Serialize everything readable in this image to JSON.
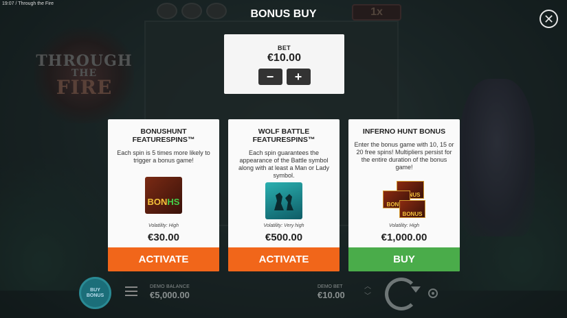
{
  "status_bar": {
    "text": "19:07  /  Through the Fire"
  },
  "background": {
    "logo_line1": "THROUGH",
    "logo_line2": "THE",
    "logo_line3": "FIRE",
    "multiplier": "1x"
  },
  "header": {
    "title": "BONUS BUY",
    "close_icon": "close-icon"
  },
  "bet": {
    "label": "BET",
    "value": "€10.00",
    "minus": "−",
    "plus": "+"
  },
  "cards": [
    {
      "title": "BONUSHUNT FEATURESPINS™",
      "description": "Each spin is 5 times more likely to trigger a bonus game!",
      "image_icon": "bonus-hunt-icon",
      "image_text_1": "BON",
      "image_text_2": "HS",
      "volatility": "Volatility: High",
      "price": "€30.00",
      "action": "ACTIVATE",
      "action_color": "#f1661a"
    },
    {
      "title": "WOLF BATTLE FEATURESPINS™",
      "description": "Each spin guarantees the appearance of the Battle symbol along with at least a Man or Lady symbol.",
      "image_icon": "wolf-battle-icon",
      "volatility": "Volatility: Very high",
      "price": "€500.00",
      "action": "ACTIVATE",
      "action_color": "#f1661a"
    },
    {
      "title": "INFERNO HUNT BONUS",
      "description": "Enter the bonus game with 10, 15 or 20 free spins! Multipliers persist for the entire duration of the bonus game!",
      "image_icon": "inferno-hunt-icon",
      "image_text": "BONUS",
      "volatility": "Volatility: High",
      "price": "€1,000.00",
      "action": "BUY",
      "action_color": "#4aac4a"
    }
  ],
  "bottom_bar": {
    "buy_bonus_label_1": "BUY",
    "buy_bonus_label_2": "BONUS",
    "balance_label": "DEMO BALANCE",
    "balance_value": "€5,000.00",
    "bet_label": "DEMO BET",
    "bet_value": "€10.00"
  }
}
